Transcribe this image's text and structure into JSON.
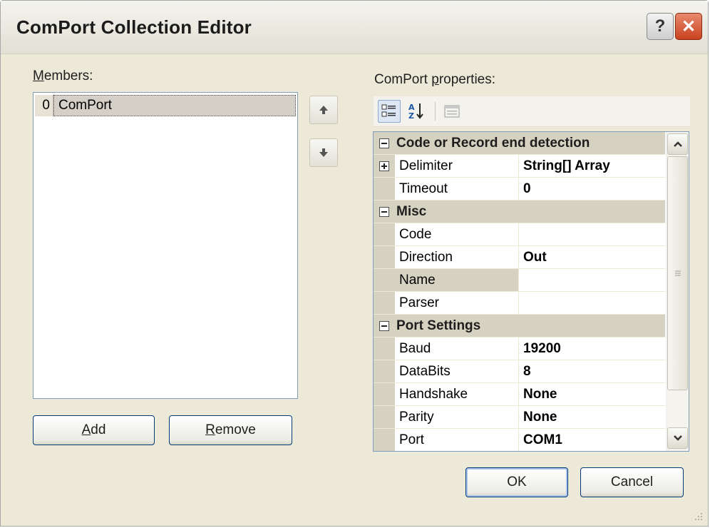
{
  "window": {
    "title": "ComPort Collection Editor",
    "help_label": "?",
    "close_label": "✕"
  },
  "members": {
    "label_prefix": "M",
    "label_rest": "embers:",
    "items": [
      {
        "index": "0",
        "name": "ComPort"
      }
    ],
    "add_prefix": "A",
    "add_rest": "dd",
    "remove_prefix": "R",
    "remove_rest": "emove"
  },
  "properties": {
    "label_start": "ComPort ",
    "label_underline": "p",
    "label_end": "roperties:",
    "toolbar": [
      "categorized-icon",
      "alphabetical-icon",
      "property-pages-icon"
    ],
    "categories": [
      {
        "name": "Code or Record end detection",
        "props": [
          {
            "name": "Delimiter",
            "value": "String[] Array",
            "expandable": true
          },
          {
            "name": "Timeout",
            "value": "0"
          }
        ]
      },
      {
        "name": "Misc",
        "props": [
          {
            "name": "Code",
            "value": ""
          },
          {
            "name": "Direction",
            "value": "Out"
          },
          {
            "name": "Name",
            "value": "",
            "selected": true
          },
          {
            "name": "Parser",
            "value": ""
          }
        ]
      },
      {
        "name": "Port Settings",
        "props": [
          {
            "name": "Baud",
            "value": "19200"
          },
          {
            "name": "DataBits",
            "value": "8"
          },
          {
            "name": "Handshake",
            "value": "None"
          },
          {
            "name": "Parity",
            "value": "None"
          },
          {
            "name": "Port",
            "value": "COM1"
          }
        ]
      }
    ]
  },
  "buttons": {
    "ok": "OK",
    "cancel": "Cancel"
  },
  "colors": {
    "dialog_bg": "#ece9d8",
    "category_bg": "#d6d2c2",
    "close_red": "#c9421e"
  }
}
